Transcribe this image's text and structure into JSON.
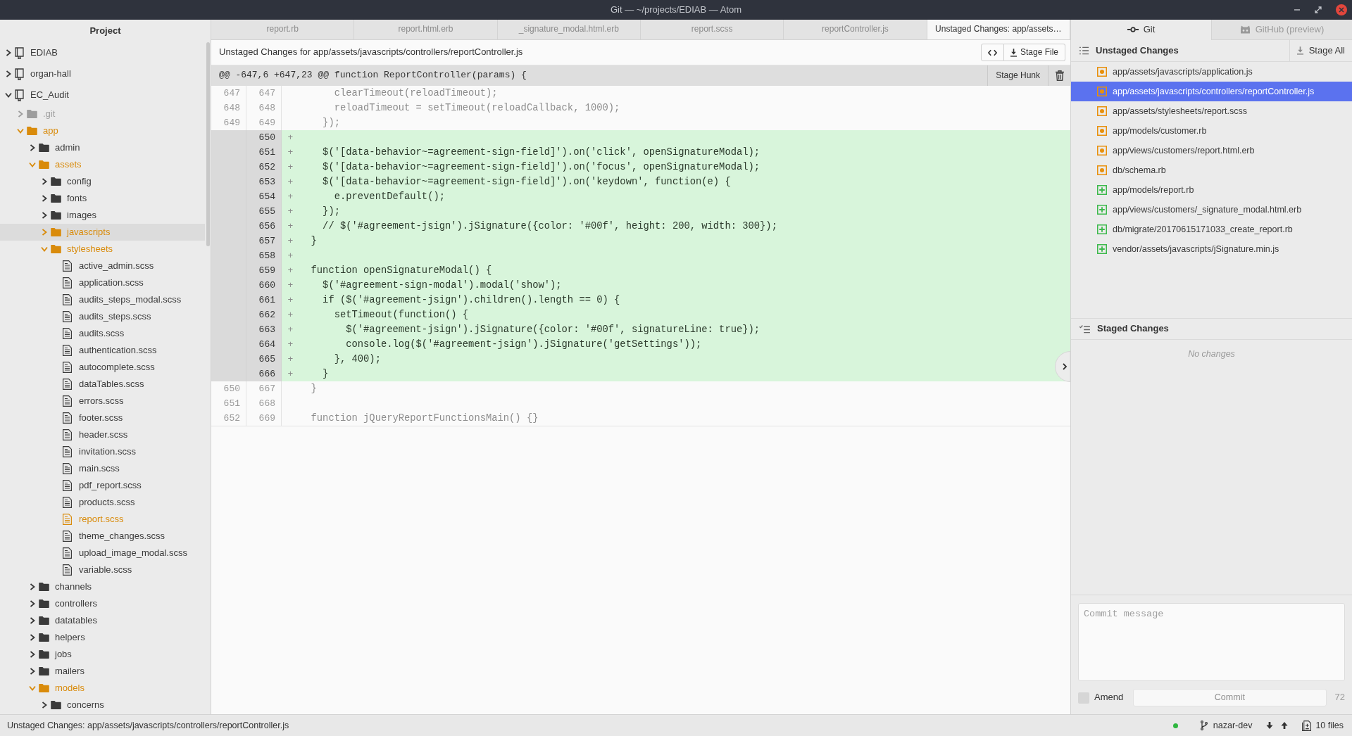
{
  "window": {
    "title": "Git — ~/projects/EDIAB — Atom"
  },
  "project_panel": {
    "title": "Project",
    "tree": [
      {
        "name": "EDIAB",
        "kind": "repo",
        "expanded": false,
        "selected": false,
        "modified": false,
        "ignored": false
      },
      {
        "name": "organ-hall",
        "kind": "repo",
        "expanded": false,
        "selected": false,
        "modified": false,
        "ignored": false
      },
      {
        "name": "EC_Audit",
        "kind": "repo",
        "expanded": true,
        "selected": false,
        "modified": false,
        "ignored": false,
        "children": [
          {
            "name": ".git",
            "kind": "folder",
            "expanded": false,
            "selected": false,
            "modified": false,
            "ignored": true
          },
          {
            "name": "app",
            "kind": "folder",
            "expanded": true,
            "selected": false,
            "modified": true,
            "ignored": false,
            "children": [
              {
                "name": "admin",
                "kind": "folder",
                "expanded": false,
                "selected": false,
                "modified": false,
                "ignored": false
              },
              {
                "name": "assets",
                "kind": "folder",
                "expanded": true,
                "selected": false,
                "modified": true,
                "ignored": false,
                "children": [
                  {
                    "name": "config",
                    "kind": "folder",
                    "expanded": false,
                    "selected": false,
                    "modified": false,
                    "ignored": false
                  },
                  {
                    "name": "fonts",
                    "kind": "folder",
                    "expanded": false,
                    "selected": false,
                    "modified": false,
                    "ignored": false
                  },
                  {
                    "name": "images",
                    "kind": "folder",
                    "expanded": false,
                    "selected": false,
                    "modified": false,
                    "ignored": false
                  },
                  {
                    "name": "javascripts",
                    "kind": "folder",
                    "expanded": false,
                    "selected": true,
                    "modified": true,
                    "ignored": false
                  },
                  {
                    "name": "stylesheets",
                    "kind": "folder",
                    "expanded": true,
                    "selected": false,
                    "modified": true,
                    "ignored": false,
                    "children": [
                      {
                        "name": "active_admin.scss",
                        "kind": "file",
                        "selected": false,
                        "modified": false,
                        "ignored": false
                      },
                      {
                        "name": "application.scss",
                        "kind": "file",
                        "selected": false,
                        "modified": false,
                        "ignored": false
                      },
                      {
                        "name": "audits_steps_modal.scss",
                        "kind": "file",
                        "selected": false,
                        "modified": false,
                        "ignored": false
                      },
                      {
                        "name": "audits_steps.scss",
                        "kind": "file",
                        "selected": false,
                        "modified": false,
                        "ignored": false
                      },
                      {
                        "name": "audits.scss",
                        "kind": "file",
                        "selected": false,
                        "modified": false,
                        "ignored": false
                      },
                      {
                        "name": "authentication.scss",
                        "kind": "file",
                        "selected": false,
                        "modified": false,
                        "ignored": false
                      },
                      {
                        "name": "autocomplete.scss",
                        "kind": "file",
                        "selected": false,
                        "modified": false,
                        "ignored": false
                      },
                      {
                        "name": "dataTables.scss",
                        "kind": "file",
                        "selected": false,
                        "modified": false,
                        "ignored": false
                      },
                      {
                        "name": "errors.scss",
                        "kind": "file",
                        "selected": false,
                        "modified": false,
                        "ignored": false
                      },
                      {
                        "name": "footer.scss",
                        "kind": "file",
                        "selected": false,
                        "modified": false,
                        "ignored": false
                      },
                      {
                        "name": "header.scss",
                        "kind": "file",
                        "selected": false,
                        "modified": false,
                        "ignored": false
                      },
                      {
                        "name": "invitation.scss",
                        "kind": "file",
                        "selected": false,
                        "modified": false,
                        "ignored": false
                      },
                      {
                        "name": "main.scss",
                        "kind": "file",
                        "selected": false,
                        "modified": false,
                        "ignored": false
                      },
                      {
                        "name": "pdf_report.scss",
                        "kind": "file",
                        "selected": false,
                        "modified": false,
                        "ignored": false
                      },
                      {
                        "name": "products.scss",
                        "kind": "file",
                        "selected": false,
                        "modified": false,
                        "ignored": false
                      },
                      {
                        "name": "report.scss",
                        "kind": "file",
                        "selected": false,
                        "modified": true,
                        "ignored": false
                      },
                      {
                        "name": "theme_changes.scss",
                        "kind": "file",
                        "selected": false,
                        "modified": false,
                        "ignored": false
                      },
                      {
                        "name": "upload_image_modal.scss",
                        "kind": "file",
                        "selected": false,
                        "modified": false,
                        "ignored": false
                      },
                      {
                        "name": "variable.scss",
                        "kind": "file",
                        "selected": false,
                        "modified": false,
                        "ignored": false
                      }
                    ]
                  }
                ]
              },
              {
                "name": "channels",
                "kind": "folder",
                "expanded": false,
                "selected": false,
                "modified": false,
                "ignored": false
              },
              {
                "name": "controllers",
                "kind": "folder",
                "expanded": false,
                "selected": false,
                "modified": false,
                "ignored": false
              },
              {
                "name": "datatables",
                "kind": "folder",
                "expanded": false,
                "selected": false,
                "modified": false,
                "ignored": false
              },
              {
                "name": "helpers",
                "kind": "folder",
                "expanded": false,
                "selected": false,
                "modified": false,
                "ignored": false
              },
              {
                "name": "jobs",
                "kind": "folder",
                "expanded": false,
                "selected": false,
                "modified": false,
                "ignored": false
              },
              {
                "name": "mailers",
                "kind": "folder",
                "expanded": false,
                "selected": false,
                "modified": false,
                "ignored": false
              },
              {
                "name": "models",
                "kind": "folder",
                "expanded": true,
                "selected": false,
                "modified": true,
                "ignored": false,
                "children": [
                  {
                    "name": "concerns",
                    "kind": "folder",
                    "expanded": false,
                    "selected": false,
                    "modified": false,
                    "ignored": false
                  }
                ]
              }
            ]
          }
        ]
      }
    ]
  },
  "tabs": [
    {
      "label": "report.rb",
      "selected": false
    },
    {
      "label": "report.html.erb",
      "selected": false
    },
    {
      "label": "_signature_modal.html.erb",
      "selected": false
    },
    {
      "label": "report.scss",
      "selected": false
    },
    {
      "label": "reportController.js",
      "selected": false
    },
    {
      "label": "Unstaged Changes: app/assets…",
      "selected": true
    }
  ],
  "diff_view": {
    "title": "Unstaged Changes for app/assets/javascripts/controllers/reportController.js",
    "stage_button": "Stage File",
    "hunk": {
      "header": "@@ -647,6 +647,23 @@ function ReportController(params) {",
      "stage_button": "Stage Hunk",
      "lines": [
        {
          "kind": "context",
          "old": "647",
          "new": "647",
          "text": "      clearTimeout(reloadTimeout);"
        },
        {
          "kind": "context",
          "old": "648",
          "new": "648",
          "text": "      reloadTimeout = setTimeout(reloadCallback, 1000);"
        },
        {
          "kind": "context",
          "old": "649",
          "new": "649",
          "text": "    });"
        },
        {
          "kind": "added",
          "new": "650",
          "sign": "+"
        },
        {
          "kind": "added",
          "new": "651",
          "sign": "+",
          "text": "    $('[data-behavior~=agreement-sign-field]').on('click', openSignatureModal);"
        },
        {
          "kind": "added",
          "new": "652",
          "sign": "+",
          "text": "    $('[data-behavior~=agreement-sign-field]').on('focus', openSignatureModal);"
        },
        {
          "kind": "added",
          "new": "653",
          "sign": "+",
          "text": "    $('[data-behavior~=agreement-sign-field]').on('keydown', function(e) {"
        },
        {
          "kind": "added",
          "new": "654",
          "sign": "+",
          "text": "      e.preventDefault();"
        },
        {
          "kind": "added",
          "new": "655",
          "sign": "+",
          "text": "    });"
        },
        {
          "kind": "added",
          "new": "656",
          "sign": "+",
          "text": "    // $('#agreement-jsign').jSignature({color: '#00f', height: 200, width: 300});"
        },
        {
          "kind": "added",
          "new": "657",
          "sign": "+",
          "text": "  }"
        },
        {
          "kind": "added",
          "new": "658",
          "sign": "+"
        },
        {
          "kind": "added",
          "new": "659",
          "sign": "+",
          "text": "  function openSignatureModal() {"
        },
        {
          "kind": "added",
          "new": "660",
          "sign": "+",
          "text": "    $('#agreement-sign-modal').modal('show');"
        },
        {
          "kind": "added",
          "new": "661",
          "sign": "+",
          "text": "    if ($('#agreement-jsign').children().length == 0) {"
        },
        {
          "kind": "added",
          "new": "662",
          "sign": "+",
          "text": "      setTimeout(function() {"
        },
        {
          "kind": "added",
          "new": "663",
          "sign": "+",
          "text": "        $('#agreement-jsign').jSignature({color: '#00f', signatureLine: true});"
        },
        {
          "kind": "added",
          "new": "664",
          "sign": "+",
          "text": "        console.log($('#agreement-jsign').jSignature('getSettings'));"
        },
        {
          "kind": "added",
          "new": "665",
          "sign": "+",
          "text": "      }, 400);"
        },
        {
          "kind": "added",
          "new": "666",
          "sign": "+",
          "text": "    }"
        },
        {
          "kind": "context",
          "old": "650",
          "new": "667",
          "text": "  }"
        },
        {
          "kind": "context",
          "old": "651",
          "new": "668"
        },
        {
          "kind": "context",
          "old": "652",
          "new": "669",
          "text": "  function jQueryReportFunctionsMain() {}"
        }
      ]
    }
  },
  "git_panel": {
    "tabs": [
      {
        "label": "Git",
        "kind": "git",
        "selected": true
      },
      {
        "label": "GitHub (preview)",
        "kind": "github",
        "selected": false
      }
    ],
    "unstaged": {
      "title": "Unstaged Changes",
      "stage_button": "Stage All",
      "files": [
        {
          "path": "app/assets/javascripts/application.js",
          "kind": "modified",
          "selected": false
        },
        {
          "path": "app/assets/javascripts/controllers/reportController.js",
          "kind": "modified",
          "selected": true
        },
        {
          "path": "app/assets/stylesheets/report.scss",
          "kind": "modified",
          "selected": false
        },
        {
          "path": "app/models/customer.rb",
          "kind": "modified",
          "selected": false
        },
        {
          "path": "app/views/customers/report.html.erb",
          "kind": "modified",
          "selected": false
        },
        {
          "path": "db/schema.rb",
          "kind": "modified",
          "selected": false
        },
        {
          "path": "app/models/report.rb",
          "kind": "added",
          "selected": false
        },
        {
          "path": "app/views/customers/_signature_modal.html.erb",
          "kind": "added",
          "selected": false
        },
        {
          "path": "db/migrate/20170615171033_create_report.rb",
          "kind": "added",
          "selected": false
        },
        {
          "path": "vendor/assets/javascripts/jSignature.min.js",
          "kind": "added",
          "selected": false
        }
      ]
    },
    "staged": {
      "title": "Staged Changes",
      "empty_text": "No changes"
    },
    "commit": {
      "placeholder": "Commit message",
      "amend": {
        "label": "Amend",
        "checked": false
      },
      "button": {
        "label": "Commit",
        "disabled": true
      },
      "remaining": "72"
    }
  },
  "status_bar": {
    "text": "Unstaged Changes: app/assets/javascripts/controllers/reportController.js",
    "branch": "nazar-dev",
    "changes": "10 files"
  }
}
